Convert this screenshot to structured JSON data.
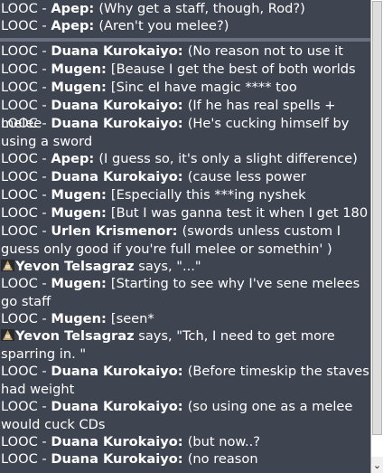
{
  "chat": {
    "channel": "LOOC",
    "separator": " - ",
    "messages": [
      {
        "type": "looc",
        "speaker": "Apep",
        "text": "(Why get a staff, though, Rod?)"
      },
      {
        "type": "looc",
        "speaker": "Apep",
        "text": "(Aren't you melee?)"
      },
      {
        "type": "looc",
        "speaker": "Duana Kurokaiyo",
        "text": "(No reason not to use it"
      },
      {
        "type": "looc",
        "speaker": "Mugen",
        "text": "[Beause I get the best of both worlds"
      },
      {
        "type": "looc",
        "speaker": "Mugen",
        "text": "[Sinc eI have magic **** too"
      },
      {
        "type": "looc",
        "speaker": "Duana Kurokaiyo",
        "text": "(If he has real spells + melee"
      },
      {
        "type": "looc",
        "speaker": "Duana Kurokaiyo",
        "text": "(He's cucking himself by using a sword"
      },
      {
        "type": "looc",
        "speaker": "Apep",
        "text": "(I guess so, it's only a slight difference)"
      },
      {
        "type": "looc",
        "speaker": "Duana Kurokaiyo",
        "text": "(cause less power"
      },
      {
        "type": "looc",
        "speaker": "Mugen",
        "text": "[Especially this ***ing nyshek"
      },
      {
        "type": "looc",
        "speaker": "Mugen",
        "text": "[But I was ganna test it when I get 180"
      },
      {
        "type": "looc",
        "speaker": "Urlen Krismenor",
        "text": "(swords unless custom I guess only good if you're full melee or somethin' )"
      },
      {
        "type": "say",
        "speaker": "Yevon Telsagraz",
        "text": " says, \"...\""
      },
      {
        "type": "looc",
        "speaker": "Mugen",
        "text": "[Starting to see why I've sene melees go staff"
      },
      {
        "type": "looc",
        "speaker": "Mugen",
        "text": "[seen*"
      },
      {
        "type": "say",
        "speaker": "Yevon Telsagraz",
        "text": " says, \"Tch, I need to get more sparring in. \""
      },
      {
        "type": "looc",
        "speaker": "Duana Kurokaiyo",
        "text": "(Before timeskip the staves had weight"
      },
      {
        "type": "looc",
        "speaker": "Duana Kurokaiyo",
        "text": "(so using one as a melee would cuck CDs"
      },
      {
        "type": "looc",
        "speaker": "Duana Kurokaiyo",
        "text": "(but now..?"
      },
      {
        "type": "looc",
        "speaker": "Duana Kurokaiyo",
        "text": "(no reason"
      }
    ]
  },
  "scrollbar": {
    "down_arrow_icon": "chevron-down-icon",
    "down_glyph": "⌄"
  },
  "colors": {
    "background": "#3f4451",
    "text": "#ffffff",
    "divider": "#6b7080"
  }
}
